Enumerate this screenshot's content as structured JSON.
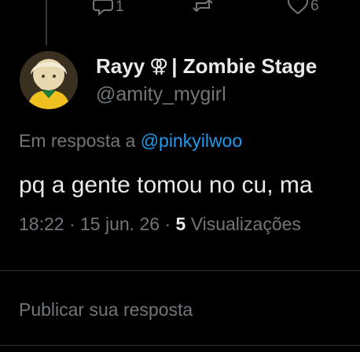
{
  "actions": {
    "reply_count": "1",
    "retweet_count": "",
    "like_count": "6"
  },
  "author": {
    "display_name": "Rayy",
    "name_symbol": "⚢",
    "name_suffix": "| Zombie Stage",
    "handle": "@amity_mygirl"
  },
  "reply_to": {
    "prefix": "Em resposta a",
    "mention": "@pinkyilwoo"
  },
  "tweet": {
    "text": "pq a gente tomou no cu, ma"
  },
  "meta": {
    "time": "18:22",
    "date": "15 jun. 26",
    "views_count": "5",
    "views_label": "Visualizações"
  },
  "composer": {
    "placeholder": "Publicar sua resposta"
  },
  "colors": {
    "background": "#000000",
    "text_primary": "#e7e9ea",
    "text_secondary": "#71767b",
    "link": "#1d9bf0",
    "divider": "#2f3336"
  }
}
